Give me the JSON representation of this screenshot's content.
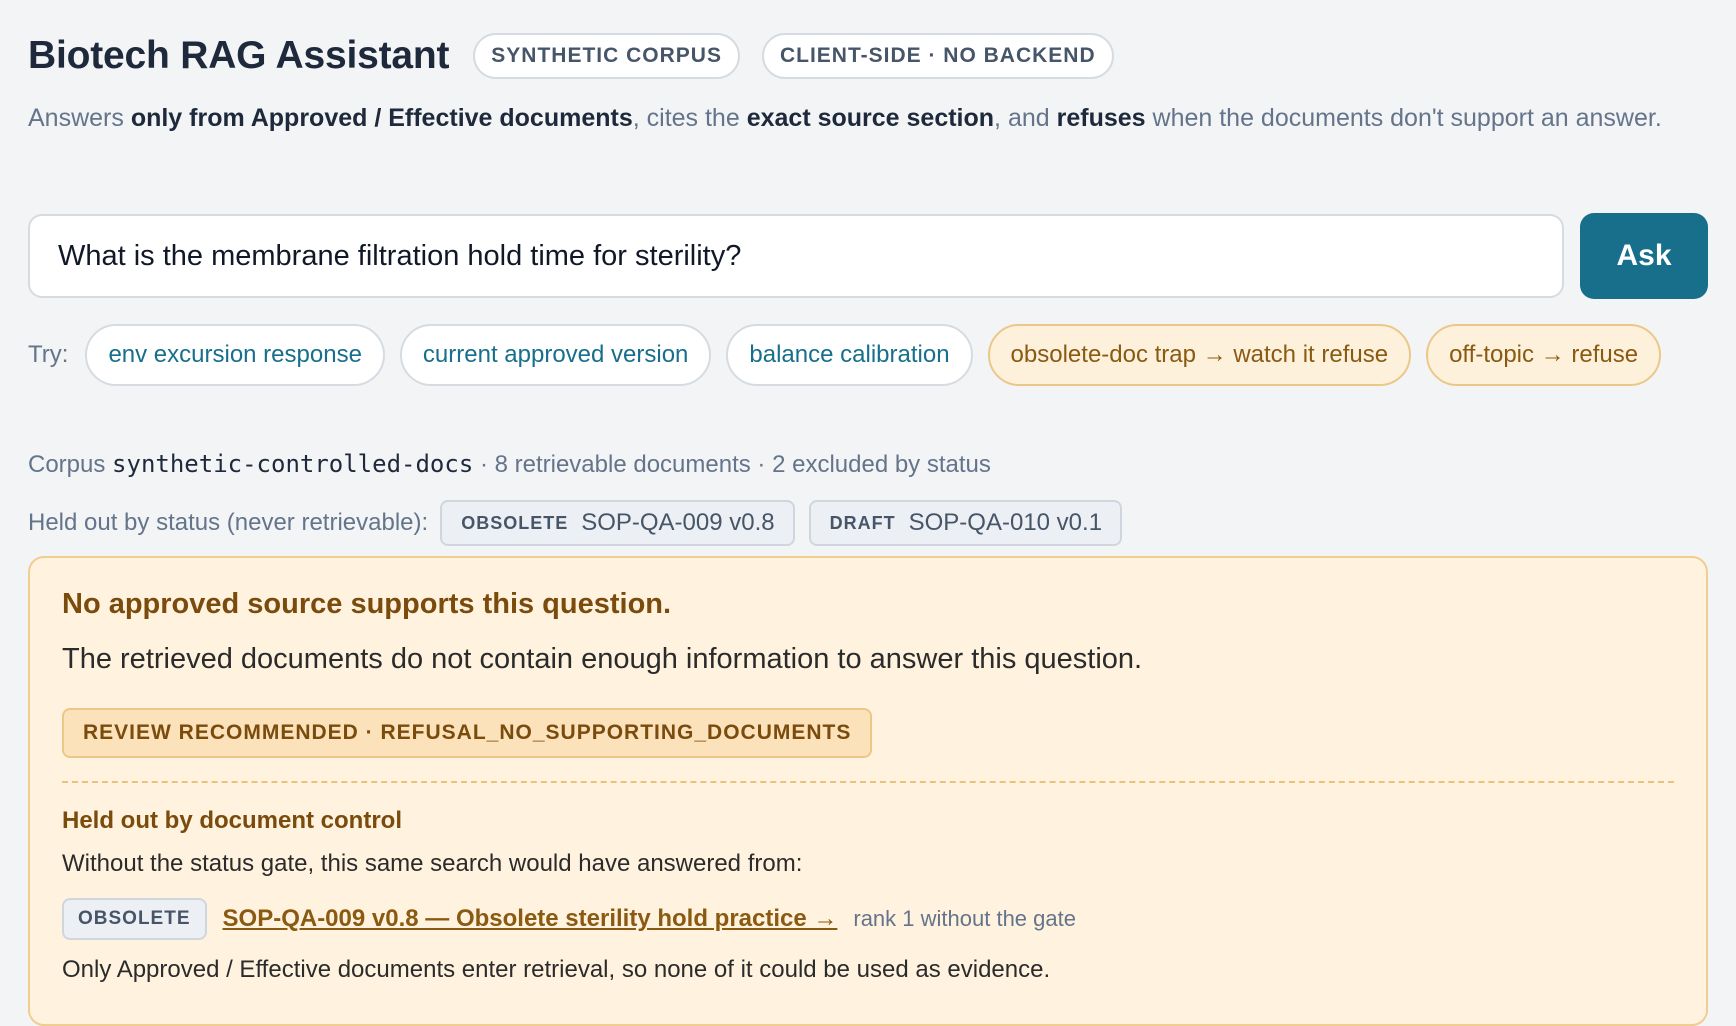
{
  "header": {
    "title": "Biotech RAG Assistant",
    "tags": [
      "SYNTHETIC CORPUS",
      "CLIENT-SIDE · NO BACKEND"
    ],
    "subtitle": {
      "p1": "Answers ",
      "b1": "only from Approved / Effective documents",
      "p2": ", cites the ",
      "b2": "exact source section",
      "p3": ", and ",
      "b3": "refuses",
      "p4": " when the documents don't support an answer."
    }
  },
  "search": {
    "value": "What is the membrane filtration hold time for sterility?",
    "ask_label": "Ask"
  },
  "try": {
    "label": "Try:",
    "chips": [
      {
        "label": "env excursion response",
        "kind": "normal"
      },
      {
        "label": "current approved version",
        "kind": "normal"
      },
      {
        "label": "balance calibration",
        "kind": "normal"
      },
      {
        "label": "obsolete-doc trap → watch it refuse",
        "kind": "trap"
      },
      {
        "label": "off-topic → refuse",
        "kind": "trap"
      }
    ]
  },
  "corpus": {
    "prefix": "Corpus ",
    "name": "synthetic-controlled-docs",
    "stats": " · 8 retrievable documents · 2 excluded by status"
  },
  "held_out_status": {
    "label": "Held out by status (never retrievable):",
    "items": [
      {
        "status": "OBSOLETE",
        "doc": "SOP-QA-009 v0.8"
      },
      {
        "status": "DRAFT",
        "doc": "SOP-QA-010 v0.1"
      }
    ]
  },
  "answer": {
    "heading": "No approved source supports this question.",
    "message": "The retrieved documents do not contain enough information to answer this question.",
    "badge": "REVIEW RECOMMENDED · REFUSAL_NO_SUPPORTING_DOCUMENTS",
    "held_out_heading": "Held out by document control",
    "held_out_intro": "Without the status gate, this same search would have answered from:",
    "source": {
      "status": "OBSOLETE",
      "link": "SOP-QA-009 v0.8 — Obsolete sterility hold practice →",
      "rank": "rank 1 without the gate"
    },
    "footer": "Only Approved / Effective documents enter retrieval, so none of it could be used as evidence."
  },
  "colors": {
    "accent": "#176f8b",
    "warning_bg": "#fff3df",
    "warning_border": "#f0cd90",
    "warning_text": "#7a4b0c"
  }
}
